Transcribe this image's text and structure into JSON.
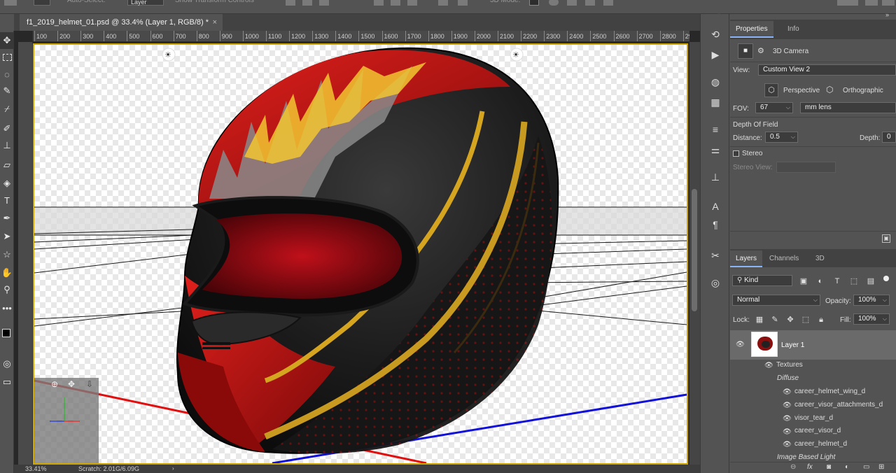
{
  "options_bar": {
    "auto_select": "Auto-Select:",
    "layer_select": "Layer",
    "show_transform": "Show Transform Controls",
    "mode_3d": "3D Mode:"
  },
  "document": {
    "tab_title": "f1_2019_helmet_01.psd @ 33.4% (Layer 1, RGB/8) *",
    "close_glyph": "×"
  },
  "ruler_top": [
    "100",
    "200",
    "300",
    "400",
    "500",
    "600",
    "700",
    "800",
    "900",
    "1000",
    "1100",
    "1200",
    "1300",
    "1400",
    "1500",
    "1600",
    "1700",
    "1800",
    "1900",
    "2000",
    "2100",
    "2200",
    "2300",
    "2400",
    "2500",
    "2600",
    "2700",
    "2800",
    "29"
  ],
  "status": {
    "zoom": "33.41%",
    "scratch": "Scratch: 2.01G/6.09G"
  },
  "properties": {
    "tab_properties": "Properties",
    "tab_info": "Info",
    "camera_title": "3D Camera",
    "view_label": "View:",
    "view_value": "Custom View 2",
    "perspective": "Perspective",
    "orthographic": "Orthographic",
    "fov_label": "FOV:",
    "fov_value": "67",
    "lens_value": "mm lens",
    "dof_label": "Depth Of Field",
    "distance_label": "Distance:",
    "distance_value": "0.5",
    "depth_label": "Depth:",
    "depth_value": "0",
    "stereo_label": "Stereo",
    "stereo_view_label": "Stereo View:"
  },
  "layers": {
    "tab_layers": "Layers",
    "tab_channels": "Channels",
    "tab_3d": "3D",
    "kind": "Kind",
    "blend_mode": "Normal",
    "opacity_label": "Opacity:",
    "opacity_value": "100%",
    "lock_label": "Lock:",
    "fill_label": "Fill:",
    "fill_value": "100%",
    "layer_name": "Layer 1",
    "textures": "Textures",
    "diffuse": "Diffuse",
    "texture_items": [
      "career_helmet_wing_d",
      "career_visor_attachments_d",
      "visor_tear_d",
      "career_visor_d",
      "career_helmet_d"
    ],
    "ibl": "Image Based Light"
  }
}
